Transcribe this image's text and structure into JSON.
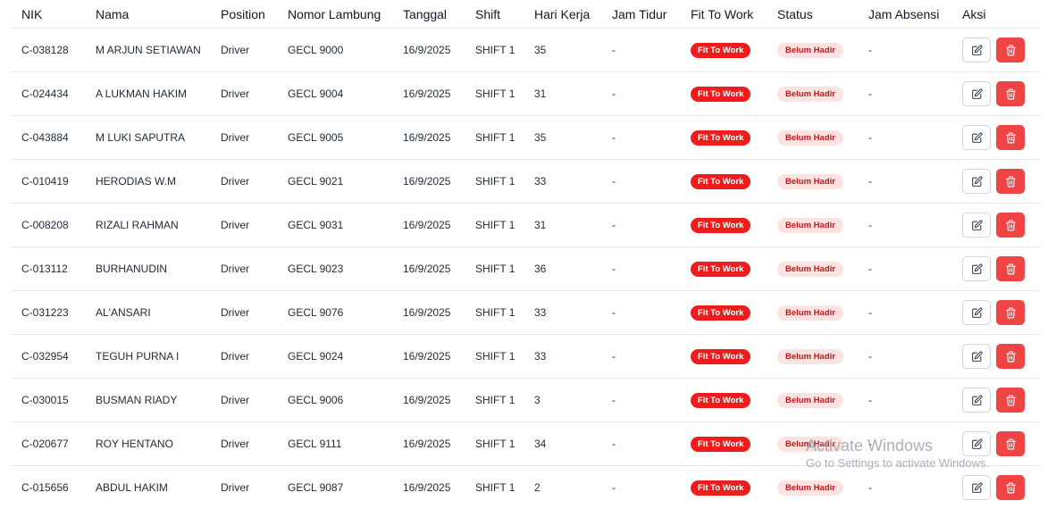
{
  "table": {
    "headers": [
      "NIK",
      "Nama",
      "Position",
      "Nomor Lambung",
      "Tanggal",
      "Shift",
      "Hari Kerja",
      "Jam Tidur",
      "Fit To Work",
      "Status",
      "Jam Absensi",
      "Aksi"
    ],
    "rows": [
      {
        "nik": "C-038128",
        "nama": "M ARJUN SETIAWAN",
        "position": "Driver",
        "nomor_lambung": "GECL 9000",
        "tanggal": "16/9/2025",
        "shift": "SHIFT 1",
        "hari_kerja": "35",
        "jam_tidur": "-",
        "fit_to_work": "Fit To Work",
        "status": "Belum Hadir",
        "jam_absensi": "-"
      },
      {
        "nik": "C-024434",
        "nama": "A LUKMAN HAKIM",
        "position": "Driver",
        "nomor_lambung": "GECL 9004",
        "tanggal": "16/9/2025",
        "shift": "SHIFT 1",
        "hari_kerja": "31",
        "jam_tidur": "-",
        "fit_to_work": "Fit To Work",
        "status": "Belum Hadir",
        "jam_absensi": "-"
      },
      {
        "nik": "C-043884",
        "nama": "M LUKI SAPUTRA",
        "position": "Driver",
        "nomor_lambung": "GECL 9005",
        "tanggal": "16/9/2025",
        "shift": "SHIFT 1",
        "hari_kerja": "35",
        "jam_tidur": "-",
        "fit_to_work": "Fit To Work",
        "status": "Belum Hadir",
        "jam_absensi": "-"
      },
      {
        "nik": "C-010419",
        "nama": "HERODIAS W.M",
        "position": "Driver",
        "nomor_lambung": "GECL 9021",
        "tanggal": "16/9/2025",
        "shift": "SHIFT 1",
        "hari_kerja": "33",
        "jam_tidur": "-",
        "fit_to_work": "Fit To Work",
        "status": "Belum Hadir",
        "jam_absensi": "-"
      },
      {
        "nik": "C-008208",
        "nama": "RIZALI RAHMAN",
        "position": "Driver",
        "nomor_lambung": "GECL 9031",
        "tanggal": "16/9/2025",
        "shift": "SHIFT 1",
        "hari_kerja": "31",
        "jam_tidur": "-",
        "fit_to_work": "Fit To Work",
        "status": "Belum Hadir",
        "jam_absensi": "-"
      },
      {
        "nik": "C-013112",
        "nama": "BURHANUDIN",
        "position": "Driver",
        "nomor_lambung": "GECL 9023",
        "tanggal": "16/9/2025",
        "shift": "SHIFT 1",
        "hari_kerja": "36",
        "jam_tidur": "-",
        "fit_to_work": "Fit To Work",
        "status": "Belum Hadir",
        "jam_absensi": "-"
      },
      {
        "nik": "C-031223",
        "nama": "AL'ANSARI",
        "position": "Driver",
        "nomor_lambung": "GECL 9076",
        "tanggal": "16/9/2025",
        "shift": "SHIFT 1",
        "hari_kerja": "33",
        "jam_tidur": "-",
        "fit_to_work": "Fit To Work",
        "status": "Belum Hadir",
        "jam_absensi": "-"
      },
      {
        "nik": "C-032954",
        "nama": "TEGUH PURNA I",
        "position": "Driver",
        "nomor_lambung": "GECL 9024",
        "tanggal": "16/9/2025",
        "shift": "SHIFT 1",
        "hari_kerja": "33",
        "jam_tidur": "-",
        "fit_to_work": "Fit To Work",
        "status": "Belum Hadir",
        "jam_absensi": "-"
      },
      {
        "nik": "C-030015",
        "nama": "BUSMAN RIADY",
        "position": "Driver",
        "nomor_lambung": "GECL 9006",
        "tanggal": "16/9/2025",
        "shift": "SHIFT 1",
        "hari_kerja": "3",
        "jam_tidur": "-",
        "fit_to_work": "Fit To Work",
        "status": "Belum Hadir",
        "jam_absensi": "-"
      },
      {
        "nik": "C-020677",
        "nama": "ROY HENTANO",
        "position": "Driver",
        "nomor_lambung": "GECL 9111",
        "tanggal": "16/9/2025",
        "shift": "SHIFT 1",
        "hari_kerja": "34",
        "jam_tidur": "-",
        "fit_to_work": "Fit To Work",
        "status": "Belum Hadir",
        "jam_absensi": "-"
      },
      {
        "nik": "C-015656",
        "nama": "ABDUL HAKIM",
        "position": "Driver",
        "nomor_lambung": "GECL 9087",
        "tanggal": "16/9/2025",
        "shift": "SHIFT 1",
        "hari_kerja": "2",
        "jam_tidur": "-",
        "fit_to_work": "Fit To Work",
        "status": "Belum Hadir",
        "jam_absensi": "-"
      }
    ],
    "actions": {
      "edit_icon": "edit-icon",
      "delete_icon": "trash-icon"
    }
  },
  "watermark": {
    "title": "Activate Windows",
    "subtitle": "Go to Settings to activate Windows."
  },
  "colors": {
    "fit_badge_bg": "#ef1c1c",
    "status_badge_bg": "#fde2e2",
    "status_badge_text": "#b91c1c",
    "delete_button_bg": "#ef4444"
  }
}
